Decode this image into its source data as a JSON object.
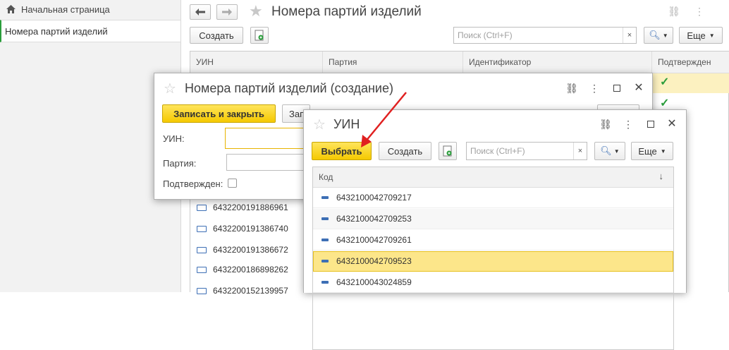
{
  "sidebar": {
    "home_label": "Начальная страница",
    "active_item": "Номера партий изделий"
  },
  "main": {
    "title": "Номера партий изделий",
    "create_label": "Создать",
    "search_placeholder": "Поиск (Ctrl+F)",
    "search_clear": "×",
    "more_label": "Еще",
    "columns": [
      "УИН",
      "Партия",
      "Идентификатор",
      "Подтвержден"
    ],
    "rows": [
      "6432200191886961",
      "6432200191386740",
      "6432200191386672",
      "6432200186898262",
      "6432200152139957"
    ]
  },
  "dialog_create": {
    "title": "Номера партий изделий (создание)",
    "save_close_label": "Записать и закрыть",
    "save_partial_label": "Зап",
    "uin_label": "УИН:",
    "batch_label": "Партия:",
    "confirmed_label": "Подтвержден:"
  },
  "dialog_uin": {
    "title": "УИН",
    "select_label": "Выбрать",
    "create_label": "Создать",
    "search_placeholder": "Поиск (Ctrl+F)",
    "search_clear": "×",
    "more_label": "Еще",
    "column": "Код",
    "sort_icon": "↓",
    "rows": [
      "6432100042709217",
      "6432100042709253",
      "6432100042709261",
      "6432100042709523",
      "6432100043024859"
    ],
    "selected_row": 3
  },
  "colors": {
    "accent_yellow": "#f5c900",
    "arrow_red": "#e02020",
    "check_green": "#2a9d3b"
  }
}
